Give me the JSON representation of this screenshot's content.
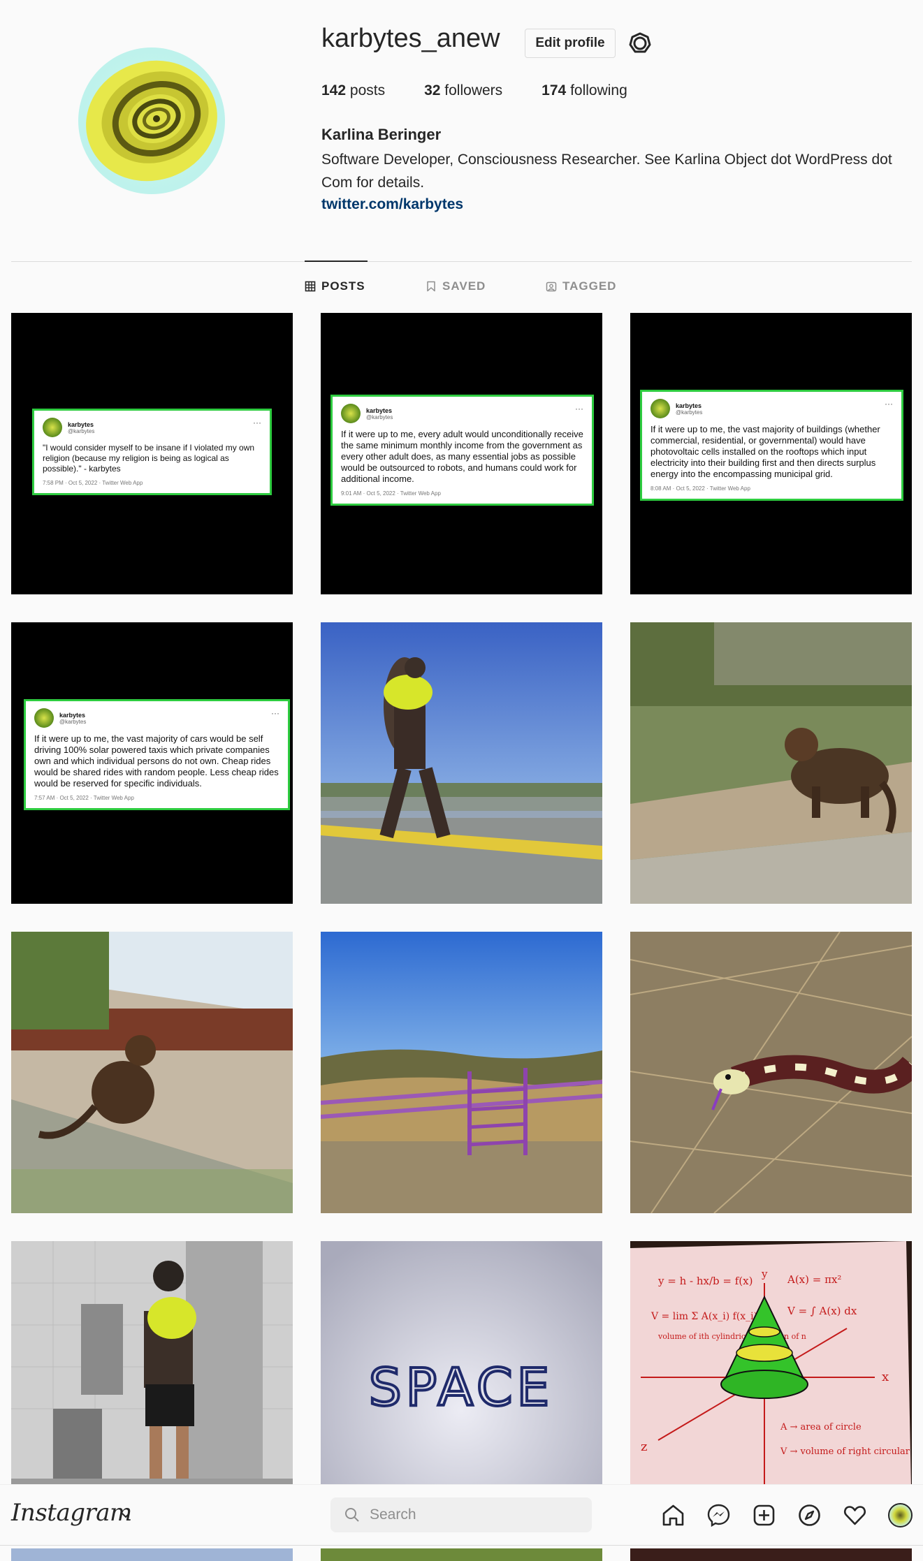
{
  "profile": {
    "username": "karbytes_anew",
    "edit_label": "Edit profile",
    "posts_count": "142",
    "posts_label": "posts",
    "followers_count": "32",
    "followers_label": "followers",
    "following_count": "174",
    "following_label": "following",
    "full_name": "Karlina Beringer",
    "bio": "Software Developer, Consciousness Researcher. See Karlina Object dot WordPress dot Com for details.",
    "link": "twitter.com/karbytes"
  },
  "tabs": {
    "posts": "POSTS",
    "saved": "SAVED",
    "tagged": "TAGGED"
  },
  "tweets": [
    {
      "name": "karbytes",
      "handle": "@karbytes",
      "text": "\"I would consider myself to be insane if I violated my own religion (because my religion is being as logical as possible).\" - karbytes",
      "meta": "7:58 PM · Oct 5, 2022 · Twitter Web App"
    },
    {
      "name": "karbytes",
      "handle": "@karbytes",
      "text": "If it were up to me, every adult would unconditionally receive the same minimum monthly income from the government as every other adult does, as many essential jobs as possible would be outsourced to robots, and humans could work for additional income.",
      "meta": "9:01 AM · Oct 5, 2022 · Twitter Web App"
    },
    {
      "name": "karbytes",
      "handle": "@karbytes",
      "text": "If it were up to me, the vast majority of buildings (whether commercial, residential, or governmental) would have photovoltaic cells installed on the rooftops which input electricity into their building first and then directs surplus energy into the encompassing municipal grid.",
      "meta": "8:08 AM · Oct 5, 2022 · Twitter Web App"
    },
    {
      "name": "karbytes",
      "handle": "@karbytes",
      "text": "If it were up to me, the vast majority of cars would be self driving 100% solar powered taxis which private companies own and which individual persons do not own. Cheap rides would be shared rides with random people. Less cheap rides would be reserved for specific individuals.",
      "meta": "7:57 AM · Oct 5, 2022 · Twitter Web App"
    }
  ],
  "space_text": "SPACE",
  "math_note": {
    "line1": "y = h - hx/b = f(x)",
    "line2": "V = lim Σ A(x_i) f(x_i)",
    "line3": "volume of ith cylindrical partition of n",
    "line4": "A(x) = πx²",
    "line5": "V = ∫ A(x) dx",
    "axis_y": "y",
    "axis_x": "x",
    "axis_z": "z",
    "legend1": "A → area of circle",
    "legend2": "V → volume of right circular cone"
  },
  "nav": {
    "logo": "Instagram",
    "search_placeholder": "Search"
  },
  "icons": {
    "settings": "settings-icon",
    "grid": "grid-icon",
    "bookmark": "bookmark-icon",
    "tag": "tag-icon",
    "home": "home-icon",
    "messenger": "messenger-icon",
    "create": "plus-square-icon",
    "explore": "compass-icon",
    "activity": "heart-icon",
    "search": "search-icon",
    "chevron": "chevron-down-icon"
  }
}
